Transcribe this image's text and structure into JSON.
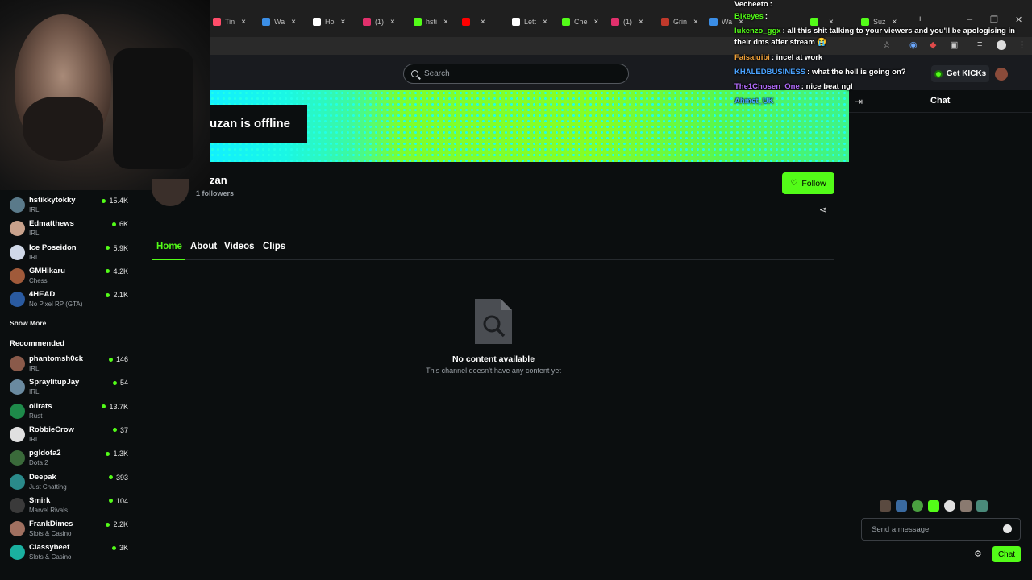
{
  "browser": {
    "tabs": [
      {
        "label": "Tin",
        "color": "#ff4d6a"
      },
      {
        "label": "Wa",
        "color": "#3b8ee6"
      },
      {
        "label": "Ho",
        "color": "#ffffff"
      },
      {
        "label": "(1)",
        "color": "#e1306c"
      },
      {
        "label": "hsti",
        "color": "#53fc18"
      },
      {
        "label": "",
        "color": "#ff0000"
      },
      {
        "label": "Lett",
        "color": "#ffffff"
      },
      {
        "label": "Che",
        "color": "#53fc18"
      },
      {
        "label": "(1)",
        "color": "#e1306c"
      },
      {
        "label": "Grin",
        "color": "#c0392b"
      },
      {
        "label": "Wa",
        "color": "#3b8ee6"
      },
      {
        "label": "",
        "color": "#53fc18"
      },
      {
        "label": "Suz",
        "color": "#53fc18"
      }
    ],
    "new_tab": "+",
    "minimize": "–",
    "maximize": "❐",
    "close": "✕"
  },
  "header": {
    "search_placeholder": "Search",
    "get_kicks": "Get KICKs"
  },
  "sidebar": {
    "following": [
      {
        "name": "hstikkytokky",
        "category": "IRL",
        "viewers": "15.4K",
        "color": "#5a7a8a"
      },
      {
        "name": "Edmatthews",
        "category": "IRL",
        "viewers": "6K",
        "color": "#c9a28c"
      },
      {
        "name": "Ice Poseidon",
        "category": "IRL",
        "viewers": "5.9K",
        "color": "#d0d8e8"
      },
      {
        "name": "GMHikaru",
        "category": "Chess",
        "viewers": "4.2K",
        "color": "#a05a3a"
      },
      {
        "name": "4HEAD",
        "category": "No Pixel RP (GTA)",
        "viewers": "2.1K",
        "color": "#2a5aa0"
      }
    ],
    "show_more": "Show More",
    "recommended_title": "Recommended",
    "recommended": [
      {
        "name": "phantomsh0ck",
        "category": "IRL",
        "viewers": "146",
        "color": "#8a5a4a"
      },
      {
        "name": "SpraylitupJay",
        "category": "IRL",
        "viewers": "54",
        "color": "#6a8aa0"
      },
      {
        "name": "oilrats",
        "category": "Rust",
        "viewers": "13.7K",
        "color": "#1e8a4a"
      },
      {
        "name": "RobbieCrow",
        "category": "IRL",
        "viewers": "37",
        "color": "#e0e0e0"
      },
      {
        "name": "pgldota2",
        "category": "Dota 2",
        "viewers": "1.3K",
        "color": "#3a6a3a"
      },
      {
        "name": "Deepak",
        "category": "Just Chatting",
        "viewers": "393",
        "color": "#2a8a8a"
      },
      {
        "name": "Smirk",
        "category": "Marvel Rivals",
        "viewers": "104",
        "color": "#3a3a3a"
      },
      {
        "name": "FrankDimes",
        "category": "Slots & Casino",
        "viewers": "2.2K",
        "color": "#a07060"
      },
      {
        "name": "Classybeef",
        "category": "Slots & Casino",
        "viewers": "3K",
        "color": "#1ab0a0"
      }
    ]
  },
  "channel": {
    "offline_text": "uzan is offline",
    "name": "zan",
    "followers": "1 followers",
    "follow_label": "Follow",
    "tabs": [
      "Home",
      "About",
      "Videos",
      "Clips"
    ],
    "empty_title": "No content available",
    "empty_subtitle": "This channel doesn't have any content yet"
  },
  "chat": {
    "title": "Chat",
    "messages": [
      {
        "user": "Vecheeto",
        "text": ":",
        "color": "#ffffff"
      },
      {
        "user": "Blkeyes",
        "text": ":",
        "color": "#53fc18"
      },
      {
        "user": "lukenzo_ggx",
        "text": ": all this shit talking to your viewers and you'll be apologising in",
        "color": "#53fc18"
      },
      {
        "user": "",
        "text": "their dms after stream 😭",
        "color": "#ffffff"
      },
      {
        "user": "Faisaluibi",
        "text": ": incel at work",
        "color": "#f2a33a"
      },
      {
        "user": "KHALEDBUSINESS",
        "text": ": what the hell is going on?",
        "color": "#4aa3ff"
      },
      {
        "user": "The1Chosen_One",
        "text": ": nice beat ngl",
        "color": "#b56cff"
      },
      {
        "user": "Ahmet_UK",
        "text": "",
        "color": "#4aa3ff"
      }
    ],
    "input_placeholder": "Send a message",
    "send_label": "Chat"
  }
}
